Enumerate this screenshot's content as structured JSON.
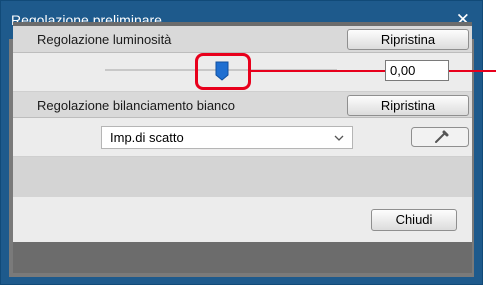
{
  "window": {
    "title": "Regolazione preliminare"
  },
  "brightness": {
    "label": "Regolazione luminosità",
    "reset_label": "Ripristina",
    "value": "0,00",
    "slider_level": 0.5
  },
  "white_balance": {
    "label": "Regolazione bilanciamento bianco",
    "reset_label": "Ripristina",
    "selected": "Imp.di scatto"
  },
  "footer": {
    "close_label": "Chiudi"
  },
  "icons": {
    "close": "close-icon",
    "dropdown": "chevron-down-icon",
    "picker": "eyedropper-icon"
  },
  "colors": {
    "accent": "#1e5a8c",
    "thumb": "#1f6fd1",
    "highlight": "#e8001c"
  }
}
